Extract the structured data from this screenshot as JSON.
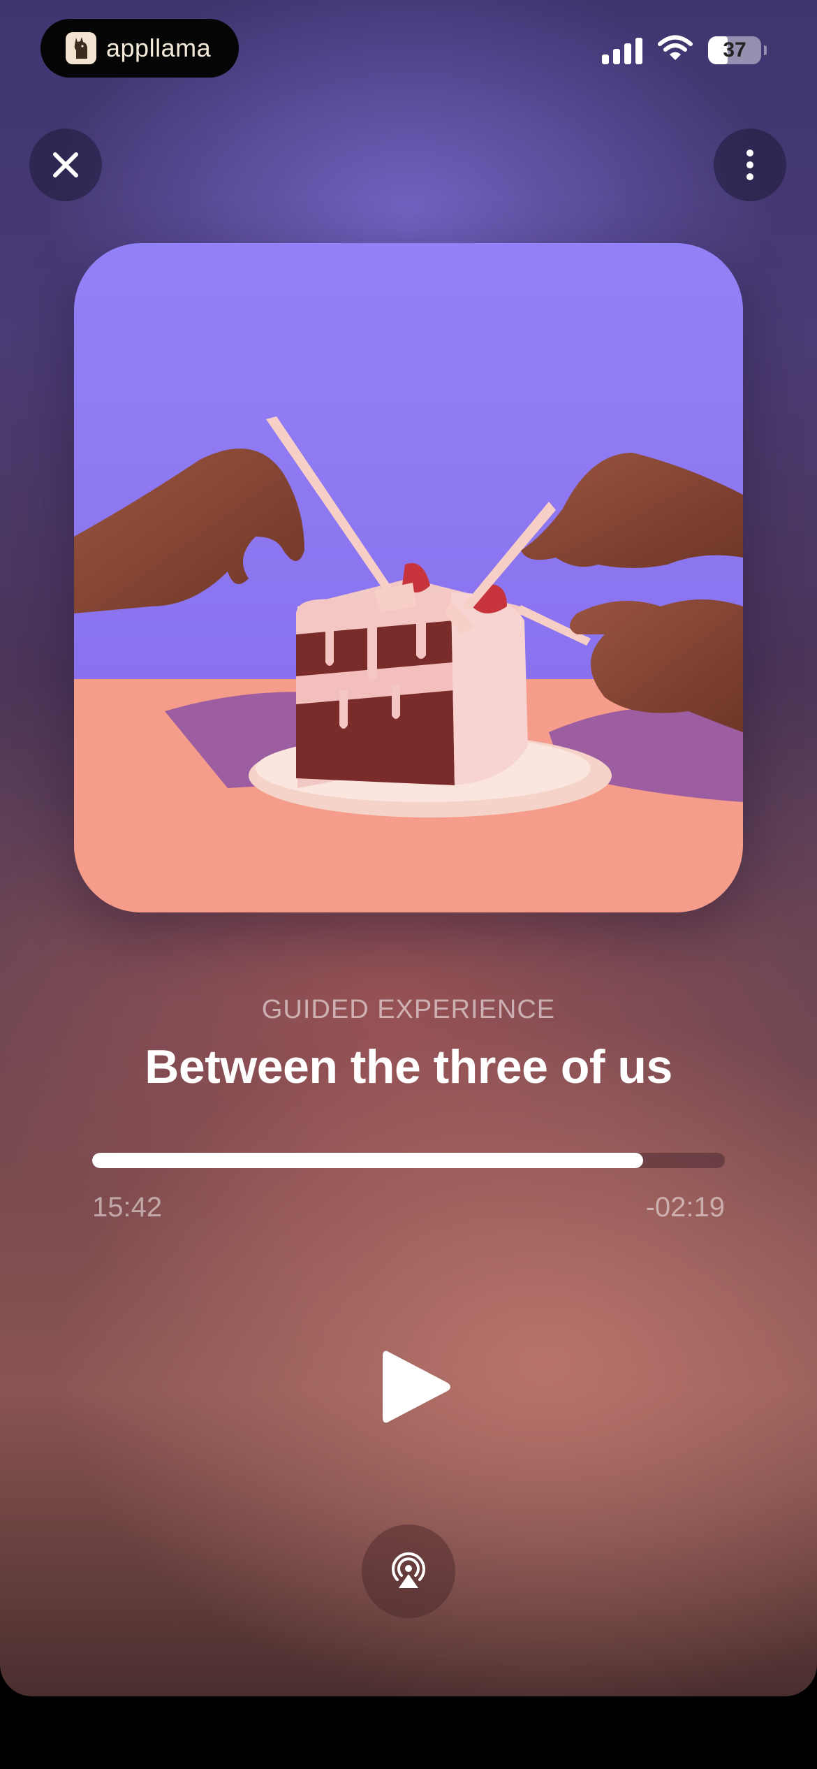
{
  "status_bar": {
    "app_name": "appllama",
    "app_icon": "llama-icon",
    "battery_level": "37",
    "battery_fraction": 0.37,
    "signal_icon": "cellular-signal-icon",
    "wifi_icon": "wifi-icon"
  },
  "controls": {
    "close_icon": "close-icon",
    "more_icon": "more-vertical-icon",
    "play_icon": "play-icon",
    "airplay_icon": "airplay-icon"
  },
  "artwork": {
    "subject": "hands-with-forks-reaching-for-cake-slice"
  },
  "track": {
    "category": "GUIDED EXPERIENCE",
    "title": "Between the three of us",
    "elapsed": "15:42",
    "remaining": "-02:19",
    "progress_fraction": 0.871
  },
  "colors": {
    "artwork_sky": "#8f7cf5",
    "artwork_table": "#f49c8b",
    "accent": "#ffffff"
  }
}
